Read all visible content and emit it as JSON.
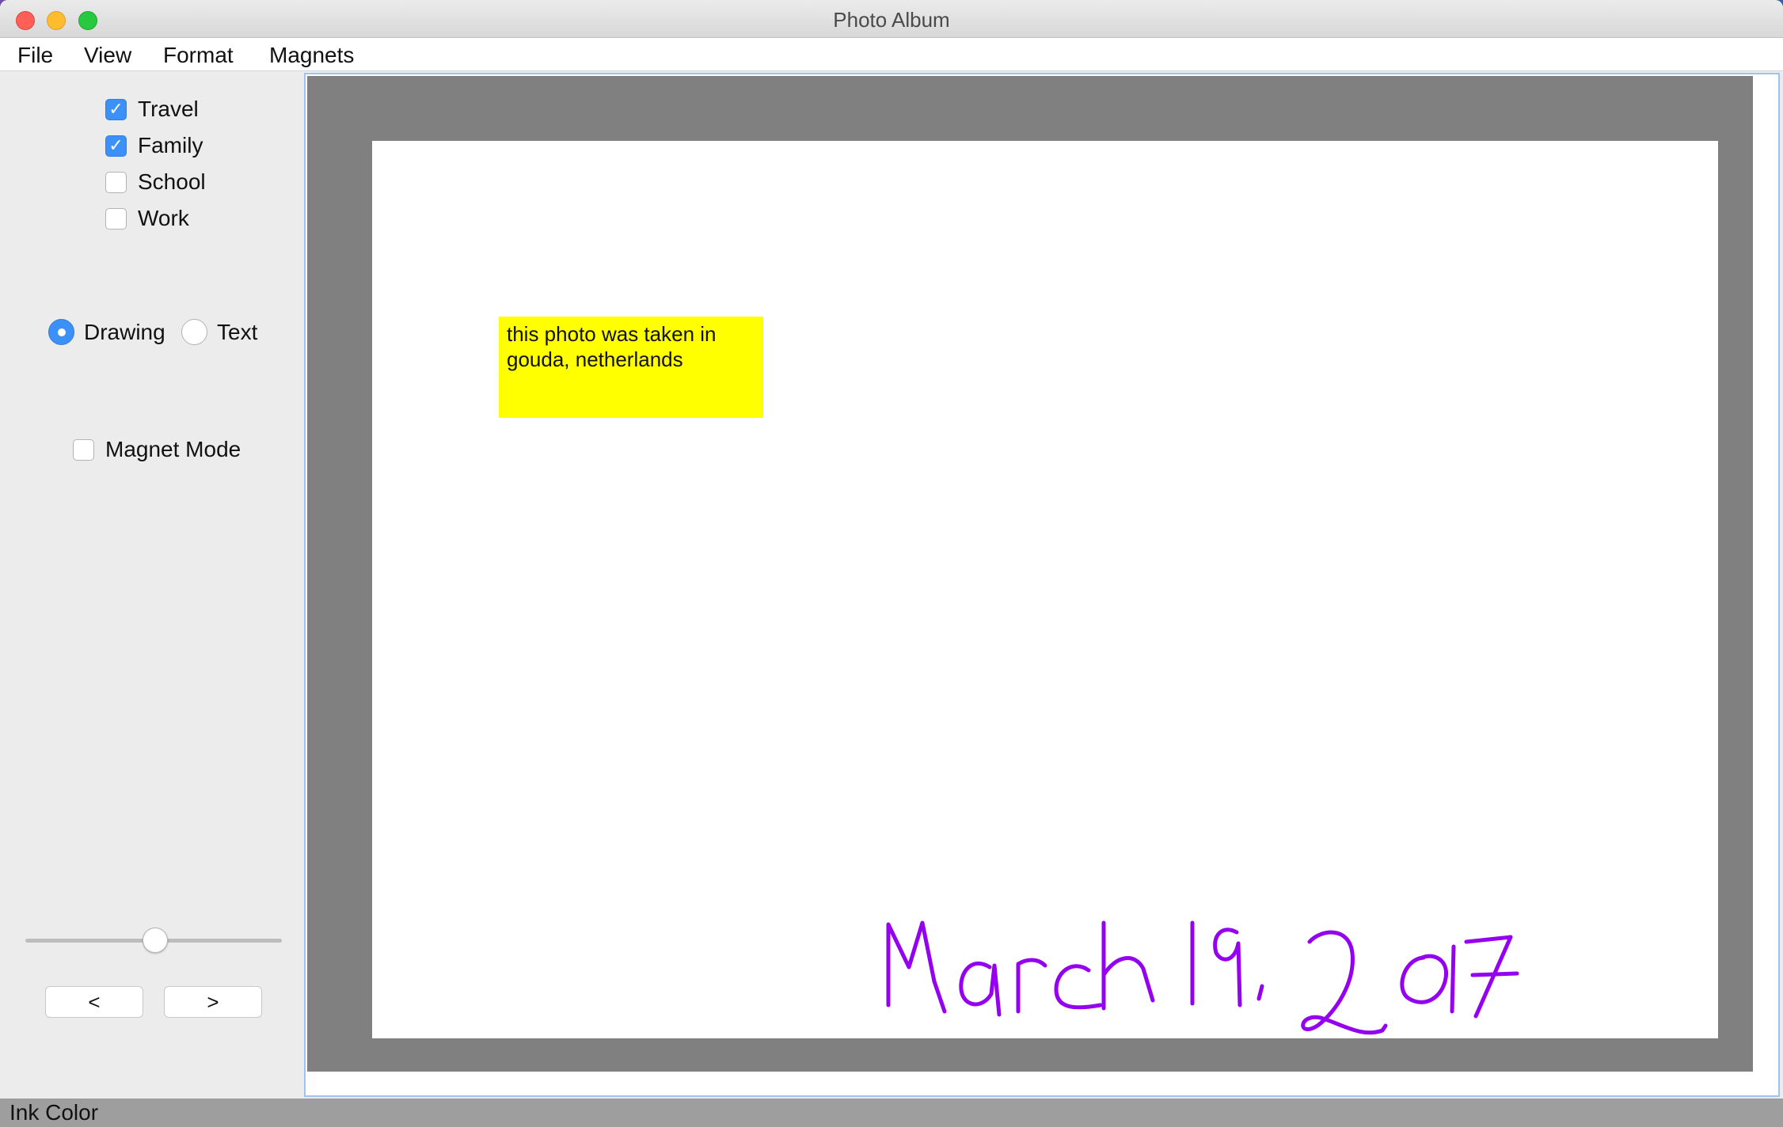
{
  "window": {
    "title": "Photo Album"
  },
  "menu": {
    "items": [
      "File",
      "View",
      "Format",
      "Magnets"
    ]
  },
  "sidebar": {
    "tags": [
      {
        "label": "Travel",
        "checked": true
      },
      {
        "label": "Family",
        "checked": true
      },
      {
        "label": "School",
        "checked": false
      },
      {
        "label": "Work",
        "checked": false
      }
    ],
    "mode": {
      "options": [
        {
          "label": "Drawing",
          "selected": true
        },
        {
          "label": "Text",
          "selected": false
        }
      ]
    },
    "magnet_mode": {
      "label": "Magnet Mode",
      "checked": false
    },
    "slider": {
      "value_fraction": 0.5
    },
    "nav": {
      "prev_label": "<",
      "next_label": ">"
    }
  },
  "canvas": {
    "sticky_note": {
      "text": "this photo was taken in gouda, netherlands",
      "color": "#ffff00"
    },
    "ink_annotation": {
      "text": "March 19, 2017",
      "color": "#9400f0"
    }
  },
  "statusbar": {
    "text": "Ink Color"
  },
  "colors": {
    "accent": "#3b91f7",
    "canvas_background": "#808080",
    "page": "#ffffff",
    "statusbar": "#9e9e9e"
  }
}
